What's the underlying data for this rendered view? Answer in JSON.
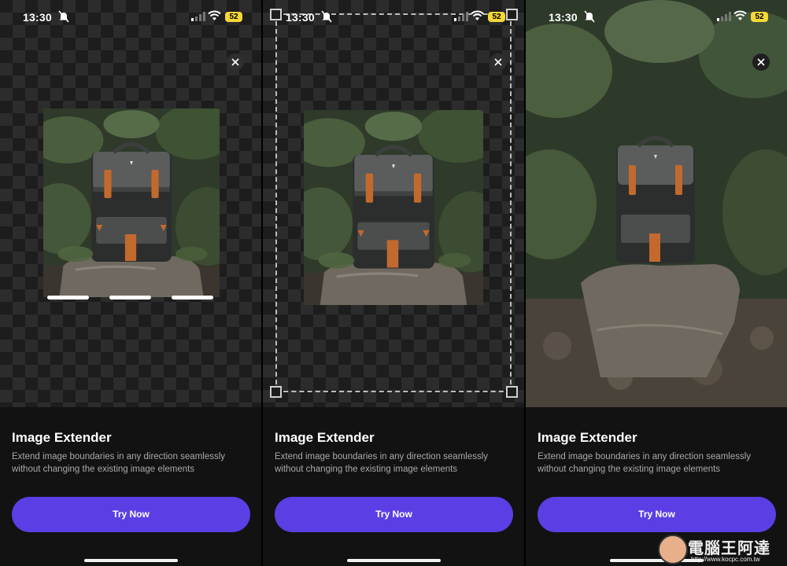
{
  "status": {
    "time": "13:30",
    "battery": "52"
  },
  "card": {
    "title": "Image Extender",
    "description": "Extend image boundaries in any direction seamlessly without changing the existing image elements",
    "button_label": "Try Now"
  },
  "watermark": {
    "name": "電腦王阿達",
    "url": "http://www.kocpc.com.tw"
  },
  "colors": {
    "accent": "#5b3fe4",
    "battery": "#f4d738",
    "background": "#121212"
  }
}
